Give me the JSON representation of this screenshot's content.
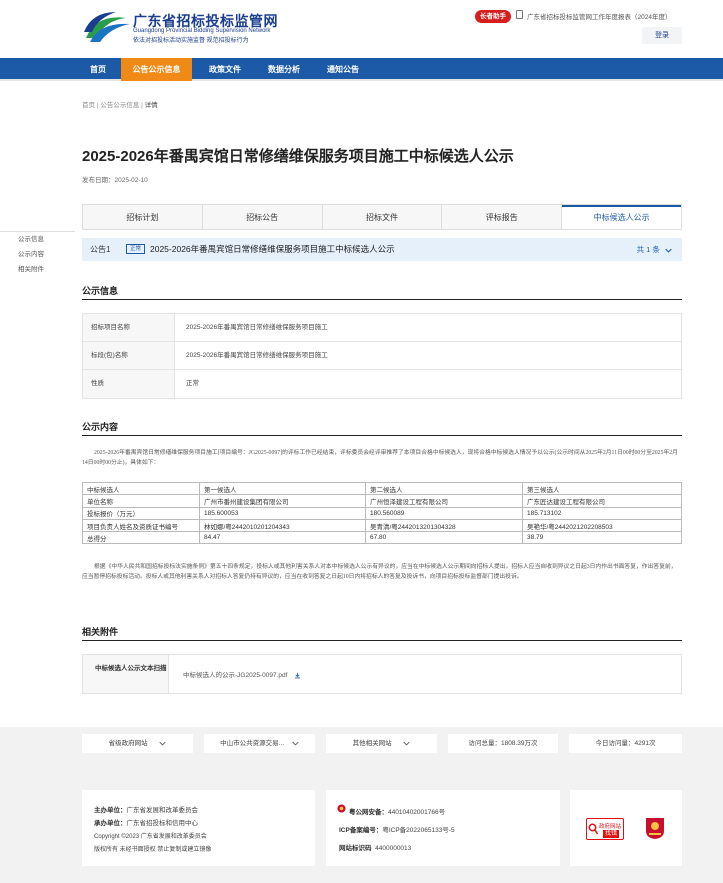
{
  "header": {
    "logo_title": "广东省招标投标监管网",
    "logo_subtitle": "Guangdong Provincial Bidding Supervision Network",
    "logo_slogan": "依法对招投标活动实施监督 规范招投标行为",
    "elder_mode": "长者助手",
    "report_link": "广东省招标投标监管网工作年度报表（2024年度）",
    "login": "登录"
  },
  "nav": {
    "items": [
      "首页",
      "公告公示信息",
      "政策文件",
      "数据分析",
      "通知公告"
    ],
    "active": "公告公示信息"
  },
  "breadcrumb": [
    "首页",
    "公告公示信息",
    "详情"
  ],
  "page": {
    "title": "2025-2026年番禺宾馆日常修缮维保服务项目施工中标候选人公示",
    "publish_date": "发布日期：2025-02-10"
  },
  "tabs": [
    "招标计划",
    "招标公告",
    "招标文件",
    "评标报告",
    "中标候选人公示"
  ],
  "left_nav": [
    "公示信息",
    "公示内容",
    "相关附件"
  ],
  "bulletin": {
    "no": "公告1",
    "badge": "正常",
    "title": "2025-2026年番禺宾馆日常修缮维保服务项目施工中标候选人公示",
    "count": "共 1 条"
  },
  "section_titles": {
    "info": "公示信息",
    "content": "公示内容",
    "attachments": "相关附件"
  },
  "info_rows": [
    {
      "label": "招标项目名称",
      "value": "2025-2026年番禺宾馆日常修缮维保服务项目施工"
    },
    {
      "label": "标段(包)名称",
      "value": "2025-2026年番禺宾馆日常修缮维保服务项目施工"
    },
    {
      "label": "性质",
      "value": "正常"
    }
  ],
  "content_paragraph_1": "2025-2026年番禺宾馆日常修缮维保服务项目施工[项目编号：JG2025-0097]的评标工作已经结束，评标委员会经评审推荐了本项目合格中标候选人，现将合格中标候选人情况予以公示(公示时间从2025年2月11日00时00分至2025年2月14日00时00分止)，具体如下：",
  "candidates": {
    "headers": [
      "中标候选人",
      "第一候选人",
      "第二候选人",
      "第三候选人"
    ],
    "rows": [
      [
        "单位名称",
        "广州市番州建设集团有限公司",
        "广州恒泽建设工程有限公司",
        "广东匠达建设工程有限公司"
      ],
      [
        "投标报价（万元）",
        "185.600053",
        "180.560089",
        "185.713102"
      ],
      [
        "项目负责人姓名及资质证书编号",
        "林如娜/粤2442010201204343",
        "吴青清/粤2442013201304328",
        "吴艳华/粤2442021202208503"
      ],
      [
        "总得分",
        "84.47",
        "67.80",
        "38.79"
      ]
    ]
  },
  "content_paragraph_2": "根据《中华人民共和国招标投标法实施条例》第五十四条规定，投标人或其他利害关系人对本中标候选人公示有异议的，应当在中标候选人公示期间向招标人提出。招标人应当自收到异议之日起3日内作出书面答复，作出答复前，应当暂停招标投标活动。投标人或其他利害关系人对招标人答复仍持有异议的，应当在收到答复之日起10日内将招标人的答复及投诉书，向项目招标投标监督部门提出投诉。",
  "attachment": {
    "label": "中标候选人公示文本扫描",
    "file": "中标候选人的公示-JG2025-0097.pdf"
  },
  "footer": {
    "selects": [
      "省级政府网站",
      "中山市公共资源交易...",
      "其他相关网站"
    ],
    "visits_total": "访问总量：1808.39万次",
    "visits_today": "今日访问量：4291次",
    "host_label": "主办单位：",
    "host": "广东省发展和改革委员会",
    "organizer_label": "承办单位：",
    "organizer": "广东省招投标和信用中心",
    "copyright": "Copyright ©2023 广东省发展和改革委员会",
    "rights": "版权所有 未经书面授权 禁止复制或建立镜像",
    "police_label": "粤公网安备：",
    "police": "44010402001766号",
    "icp_label": "ICP备案编号：",
    "icp": "粤ICP备2022065133号-5",
    "site_id_label": "网站标识码",
    "site_id": "4400000013",
    "gov_badge_1": "政府网站",
    "gov_badge_2": "找错"
  },
  "colors": {
    "nav_bg": "#1c5aa8",
    "nav_active": "#f08a17",
    "accent_blue": "#1c5aa8"
  }
}
